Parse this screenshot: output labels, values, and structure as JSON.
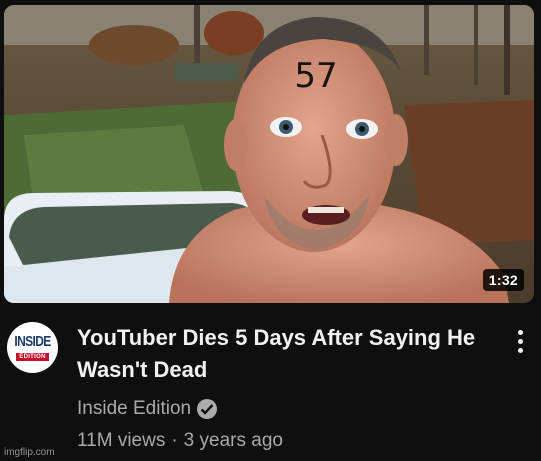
{
  "video": {
    "duration": "1:32",
    "forehead_text": "57",
    "title": "YouTuber Dies 5 Days After Saying He Wasn't Dead",
    "channel": "Inside Edition",
    "views": "11M views",
    "separator": "·",
    "age": "3 years ago"
  },
  "avatar": {
    "line1": "INSIDE",
    "line2": "EDITION"
  },
  "watermark": "imgflip.com",
  "icons": {
    "verified": "verified-check-icon",
    "menu": "more-vert-icon"
  },
  "colors": {
    "background": "#0f0f0f",
    "title_text": "#f1f1f1",
    "secondary_text": "#aaaaaa",
    "avatar_red": "#c8102e"
  }
}
